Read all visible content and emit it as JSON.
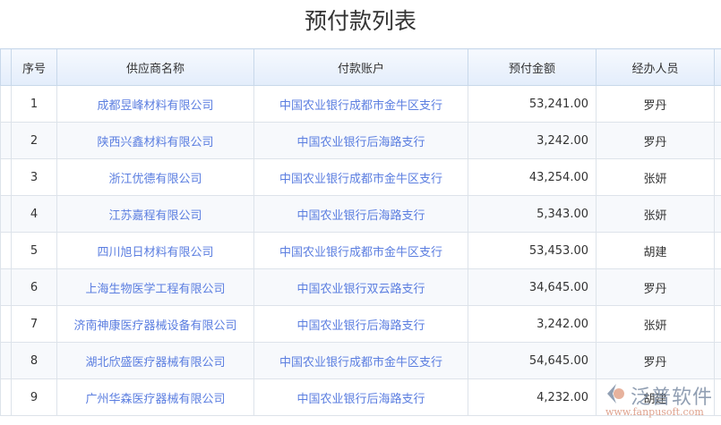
{
  "title": "预付款列表",
  "columns": [
    "序号",
    "供应商名称",
    "付款账户",
    "预付金额",
    "经办人员"
  ],
  "rows": [
    {
      "no": "1",
      "supplier": "成都昱峰材料有限公司",
      "account": "中国农业银行成都市金牛区支行",
      "amount": "53,241.00",
      "person": "罗丹"
    },
    {
      "no": "2",
      "supplier": "陕西兴鑫材料有限公司",
      "account": "中国农业银行后海路支行",
      "amount": "3,242.00",
      "person": "罗丹"
    },
    {
      "no": "3",
      "supplier": "浙江优德有限公司",
      "account": "中国农业银行成都市金牛区支行",
      "amount": "43,254.00",
      "person": "张妍"
    },
    {
      "no": "4",
      "supplier": "江苏嘉程有限公司",
      "account": "中国农业银行后海路支行",
      "amount": "5,343.00",
      "person": "张妍"
    },
    {
      "no": "5",
      "supplier": "四川旭日材料有限公司",
      "account": "中国农业银行成都市金牛区支行",
      "amount": "53,453.00",
      "person": "胡建"
    },
    {
      "no": "6",
      "supplier": "上海生物医学工程有限公司",
      "account": "中国农业银行双云路支行",
      "amount": "34,645.00",
      "person": "罗丹"
    },
    {
      "no": "7",
      "supplier": "济南神康医疗器械设备有限公司",
      "account": "中国农业银行后海路支行",
      "amount": "3,242.00",
      "person": "张妍"
    },
    {
      "no": "8",
      "supplier": "湖北欣盛医疗器械有限公司",
      "account": "中国农业银行成都市金牛区支行",
      "amount": "54,645.00",
      "person": "罗丹"
    },
    {
      "no": "9",
      "supplier": "广州华森医疗器械有限公司",
      "account": "中国农业银行后海路支行",
      "amount": "4,232.00",
      "person": "胡建"
    }
  ],
  "watermark": {
    "brand": "泛普软件",
    "url": "www.fanpusoft.com"
  }
}
